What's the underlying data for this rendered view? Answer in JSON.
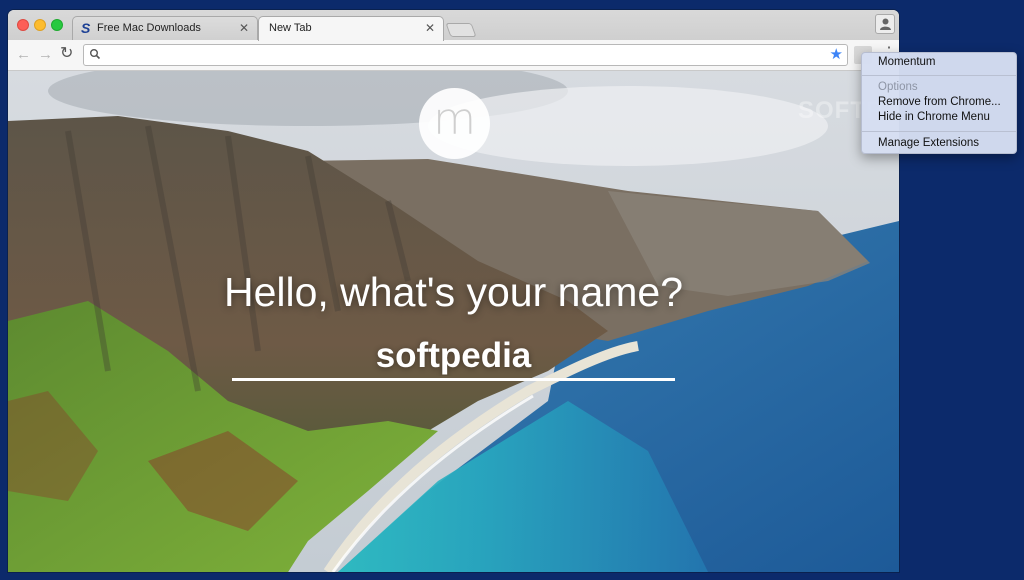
{
  "browser": {
    "tabs": [
      {
        "title": "Free Mac Downloads",
        "favicon": "S",
        "active": false
      },
      {
        "title": "New Tab",
        "active": true
      }
    ],
    "close_glyph": "✕",
    "address": {
      "value": "",
      "placeholder": ""
    },
    "icons": {
      "back": "back-arrow-icon",
      "forward": "forward-arrow-icon",
      "reload": "reload-icon",
      "search": "search-icon",
      "bookmark": "star-icon",
      "profile": "person-icon",
      "menu": "kebab-menu-icon"
    },
    "glyphs": {
      "back": "←",
      "forward": "→",
      "reload": "↻",
      "star": "★",
      "kebab": "⋮"
    }
  },
  "momentum": {
    "logo_letter": "m",
    "greeting": "Hello, what's your name?",
    "name_value": "softpedia"
  },
  "watermark": "SOFTP",
  "context_menu": {
    "items": [
      {
        "label": "Momentum",
        "enabled": true
      },
      {
        "label": "Options",
        "enabled": false
      },
      {
        "label": "Remove from Chrome...",
        "enabled": true
      },
      {
        "label": "Hide in Chrome Menu",
        "enabled": true
      },
      {
        "label": "Manage Extensions",
        "enabled": true
      }
    ]
  },
  "colors": {
    "desktop": "#0c2a6b",
    "bookmark_star": "#3d84f7",
    "menu_bg": "#d6def2"
  }
}
